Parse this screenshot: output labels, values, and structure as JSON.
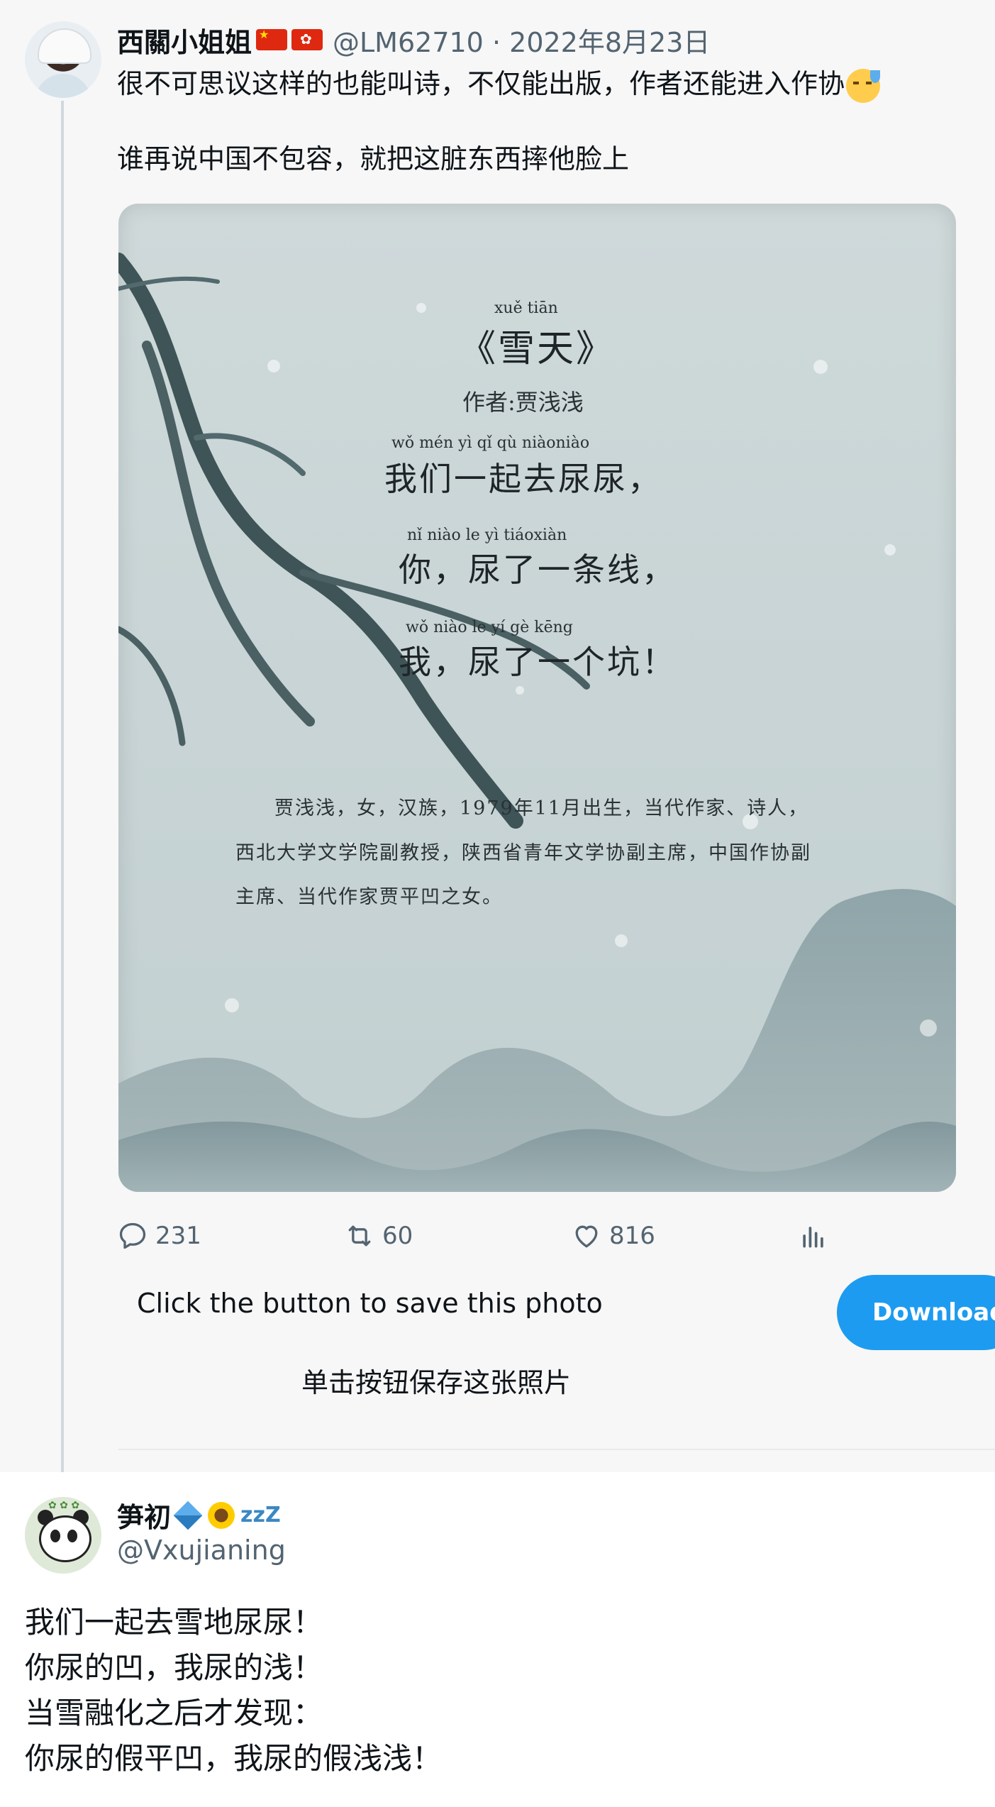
{
  "tweet": {
    "author": {
      "display_name": "西關小姐姐",
      "badges": [
        "flag-china",
        "flag-hong-kong"
      ],
      "handle": "@LM62710",
      "separator": "·",
      "date": "2022年8月23日"
    },
    "text_line1": "很不可思议这样的也能叫诗，不仅能出版，作者还能进入作协",
    "text_emoji": "downcast-sweat-emoji",
    "text_line2": "谁再说中国不包容，就把这脏东西摔他脸上",
    "photo": {
      "title_pinyin": "xuě tiān",
      "title": "《雪天》",
      "author_line": "作者:贾浅浅",
      "lines": [
        {
          "pinyin": "wǒ mén  yì   qǐ  qù  niàoniào",
          "text": "我们一起去尿尿，"
        },
        {
          "pinyin": "nǐ   niào  le   yì  tiáoxiàn",
          "text": "你，尿了一条线，"
        },
        {
          "pinyin": "wǒ   niào  le   yí   gè  kēng",
          "text": "我，尿了一个坑！"
        }
      ],
      "bio": [
        "贾浅浅，女，汉族，1979年11月出生，当代作家、诗人，",
        "西北大学文学院副教授，陕西省青年文学协副主席，中国作协副",
        "主席、当代作家贾平凹之女。"
      ]
    },
    "actions": {
      "replies": "231",
      "retweets": "60",
      "likes": "816"
    }
  },
  "save_prompt": {
    "caption": "Click the button to save this photo",
    "caption_zh": "单击按钮保存这张照片",
    "button_label": "Download"
  },
  "reply": {
    "display_name": "笋初",
    "badges": [
      "kite-emoji",
      "sunflower-emoji",
      "zzz-emoji"
    ],
    "zzz": "zzZ",
    "handle": "@Vxujianing",
    "lines": [
      "我们一起去雪地尿尿！",
      "你尿的凹，我尿的浅！",
      "当雪融化之后才发现：",
      "你尿的假平凹，我尿的假浅浅！"
    ]
  },
  "colors": {
    "accent": "#1d9bf0",
    "text_secondary": "#536471",
    "background": "#f7f7f7"
  }
}
